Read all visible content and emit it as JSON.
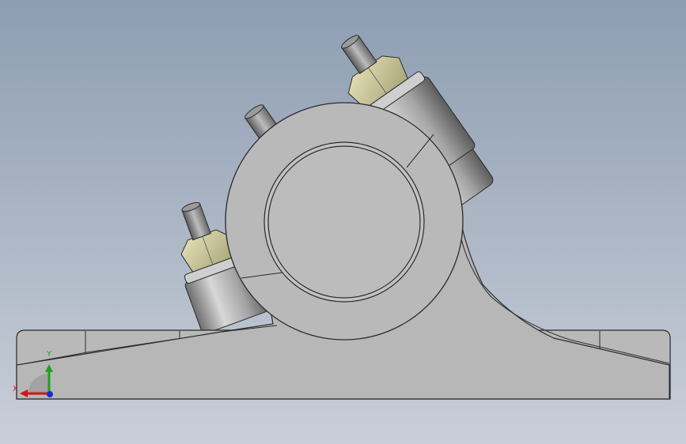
{
  "viewport": {
    "background_top": "#8d9db2",
    "background_bottom": "#c9cfd8"
  },
  "colors": {
    "part_body": "#b7b7b7",
    "part_face_light": "#c4c4c4",
    "part_edge": "#2b2b2b",
    "nut_color": "#c9c59a",
    "stud_color": "#8f8f8f"
  },
  "triad": {
    "x_label": "X",
    "y_label": "Y",
    "x_color": "#d01919",
    "y_color": "#1aa31a",
    "z_color": "#1a2bd0",
    "icon": "coordinate-triad-icon"
  }
}
